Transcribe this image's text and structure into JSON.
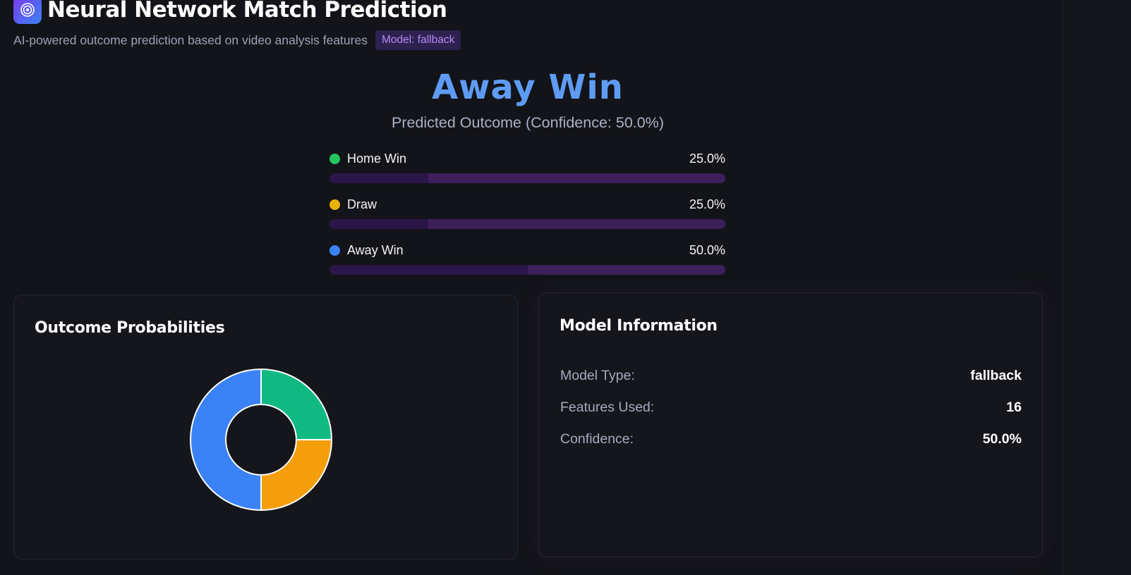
{
  "header": {
    "title": "Neural Network Match Prediction",
    "subtitle": "AI-powered outcome prediction based on video analysis features",
    "model_badge": "Model: fallback",
    "logo_icon": "target-icon"
  },
  "prediction": {
    "outcome": "Away Win",
    "subtitle": "Predicted Outcome (Confidence: 50.0%)"
  },
  "probabilities": [
    {
      "label": "Home Win",
      "pct": "25.0%",
      "value": 25.0,
      "color": "#22c55e"
    },
    {
      "label": "Draw",
      "pct": "25.0%",
      "value": 25.0,
      "color": "#eab308"
    },
    {
      "label": "Away Win",
      "pct": "50.0%",
      "value": 50.0,
      "color": "#3b82f6"
    }
  ],
  "outcome_card": {
    "title": "Outcome Probabilities"
  },
  "chart_data": {
    "type": "pie",
    "categories": [
      "Home Win",
      "Draw",
      "Away Win"
    ],
    "values": [
      25,
      25,
      50
    ],
    "colors": [
      "#10b981",
      "#f59e0b",
      "#3b82f6"
    ],
    "donut": true
  },
  "model_card": {
    "title": "Model Information",
    "rows": [
      {
        "label": "Model Type:",
        "value": "fallback"
      },
      {
        "label": "Features Used:",
        "value": "16"
      },
      {
        "label": "Confidence:",
        "value": "50.0%"
      }
    ]
  }
}
